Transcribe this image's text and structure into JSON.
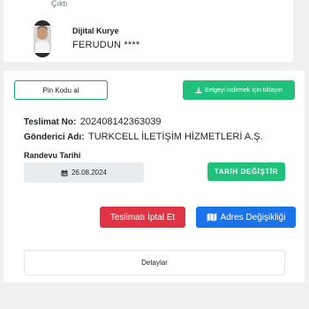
{
  "top_card": {
    "label": "Çıktı",
    "courier_role": "Dijital Kurye",
    "courier_name": "FERUDUN ****"
  },
  "actions": {
    "pin_button": "Pin Kodu al",
    "download_button": "Belgeyi indirmek için tıklayın"
  },
  "delivery": {
    "number_label": "Teslimat No:",
    "number_value": "202408142363039",
    "sender_label": "Gönderici Adı:",
    "sender_value": "TURKCELL İLETİŞİM HİZMETLERİ A.Ş."
  },
  "appointment": {
    "label": "Randevu Tarihi",
    "date": "26.08.2024",
    "change_button": "TARİH DEĞİŞTİR"
  },
  "buttons": {
    "cancel": "Teslimatı İptal Et",
    "address_change": "Adres Değişikliği",
    "details": "Detaylar"
  },
  "colors": {
    "green": "#1fc17b",
    "red": "#e03444",
    "blue": "#1a73e8",
    "date_bg": "#e9ecef"
  },
  "icons": [
    "courier-avatar",
    "download-icon",
    "calendar-icon",
    "map-icon"
  ]
}
